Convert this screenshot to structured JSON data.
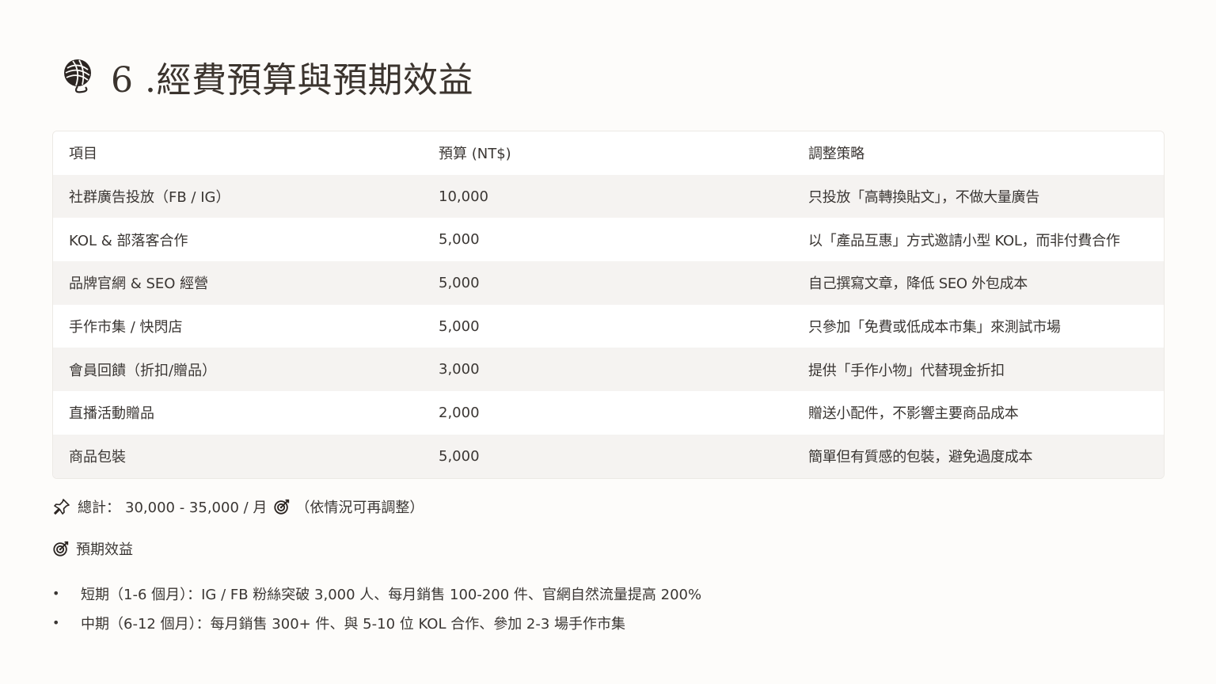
{
  "title": {
    "icon": "yarn-ball-icon",
    "text": "6 .經費預算與預期效益"
  },
  "table": {
    "headers": [
      "項目",
      "預算 (NT$)",
      "調整策略"
    ],
    "rows": [
      [
        "社群廣告投放（FB / IG）",
        "10,000",
        "只投放「高轉換貼文」，不做大量廣告"
      ],
      [
        "KOL & 部落客合作",
        "5,000",
        "以「產品互惠」方式邀請小型 KOL，而非付費合作"
      ],
      [
        "品牌官網 & SEO 經營",
        "5,000",
        "自己撰寫文章，降低 SEO 外包成本"
      ],
      [
        "手作市集 / 快閃店",
        "5,000",
        "只參加「免費或低成本市集」來測試市場"
      ],
      [
        "會員回饋（折扣/贈品）",
        "3,000",
        "提供「手作小物」代替現金折扣"
      ],
      [
        "直播活動贈品",
        "2,000",
        "贈送小配件，不影響主要商品成本"
      ],
      [
        "商品包裝",
        "5,000",
        "簡單但有質感的包裝，避免過度成本"
      ]
    ]
  },
  "total": {
    "icon": "pushpin-icon",
    "label": "總計：",
    "value": "30,000 - 35,000 / 月",
    "note_icon": "target-icon",
    "note": "（依情況可再調整）"
  },
  "benefits": {
    "icon": "target-icon",
    "heading": "預期效益",
    "items": [
      "短期（1-6 個月）：IG / FB 粉絲突破 3,000 人、每月銷售 100-200 件、官網自然流量提高 200%",
      "中期（6-12 個月）：每月銷售 300+ 件、與 5-10 位 KOL 合作、參加 2-3 場手作市集"
    ],
    "bullet": "•"
  }
}
